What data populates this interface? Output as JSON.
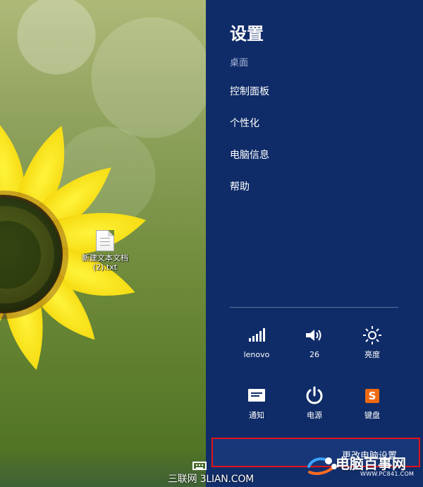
{
  "desktop": {
    "file": {
      "icon": "text-document-icon",
      "label": "新建文本文档 (2).txt"
    }
  },
  "settings_panel": {
    "title": "设置",
    "subtitle": "桌面",
    "menu": [
      {
        "label": "控制面板"
      },
      {
        "label": "个性化"
      },
      {
        "label": "电脑信息"
      },
      {
        "label": "帮助"
      }
    ],
    "quick_settings": [
      {
        "label": "lenovo",
        "icon": "wifi-signal-icon"
      },
      {
        "label": "26",
        "icon": "volume-icon"
      },
      {
        "label": "亮度",
        "icon": "brightness-icon"
      },
      {
        "label": "通知",
        "icon": "notifications-icon"
      },
      {
        "label": "电源",
        "icon": "power-icon"
      },
      {
        "label": "键盘",
        "icon": "keyboard-icon"
      }
    ],
    "bottom_action": {
      "label": "更改电脑设置"
    }
  },
  "watermarks": {
    "left": "三联网 3LIAN.COM",
    "right_main": "电脑百事网",
    "right_sub": "WWW.PC841.COM"
  },
  "colors": {
    "panel_bg": "#0f2c68",
    "highlight_border": "#e2131b",
    "accent_orange": "#f06a12"
  }
}
